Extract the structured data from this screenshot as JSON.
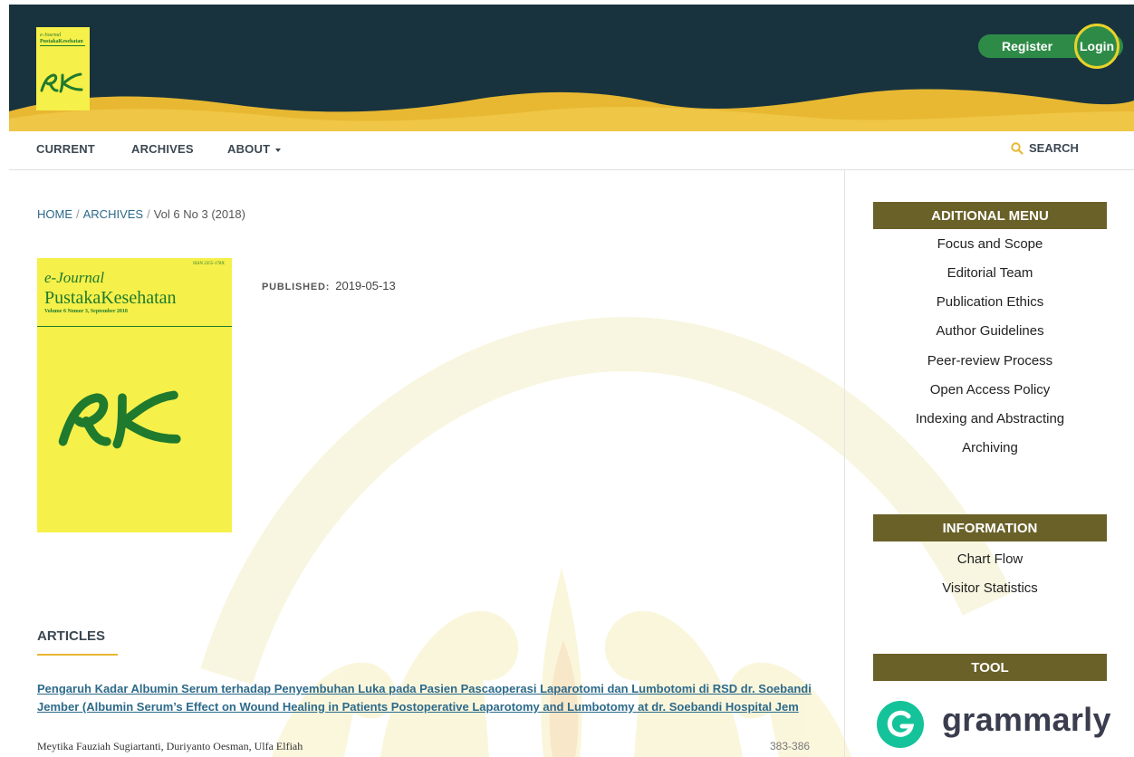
{
  "header": {
    "logo": {
      "line1": "e-Journal",
      "line2": "PustakaKesehatan",
      "mark_icon": "pk-script-logo"
    },
    "register_label": "Register",
    "login_label": "Login"
  },
  "nav": {
    "items": [
      {
        "label": "CURRENT"
      },
      {
        "label": "ARCHIVES"
      },
      {
        "label": "ABOUT"
      }
    ],
    "search_label": "SEARCH"
  },
  "breadcrumb": {
    "home": "HOME",
    "archives": "ARCHIVES",
    "current": "Vol 6 No 3 (2018)",
    "separator": "/"
  },
  "issue": {
    "cover": {
      "issn": "ISSN 2355-178X",
      "journal_italic": "e-Journal",
      "journal_name": "PustakaKesehatan",
      "volume_line": "Volume 6 Nomor 3, September 2018"
    },
    "published_label": "PUBLISHED:",
    "published_date": "2019-05-13"
  },
  "articles": {
    "heading": "ARTICLES",
    "items": [
      {
        "title": "Pengaruh Kadar Albumin Serum terhadap Penyembuhan Luka pada Pasien Pascaoperasi Laparotomi dan Lumbotomi di RSD dr. Soebandi Jember (Albumin Serum’s Effect on Wound Healing in Patients Postoperative Laparotomy and Lumbotomy at dr. Soebandi Hospital Jem",
        "authors": "Meytika Fauziah Sugiartanti, Duriyanto Oesman, Ulfa Elfiah",
        "pages": "383-386"
      }
    ]
  },
  "sidebar": {
    "additional_menu": {
      "title": "ADITIONAL MENU",
      "items": [
        "Focus and Scope",
        "Editorial Team",
        "Publication Ethics",
        "Author Guidelines",
        "Peer-review Process",
        "Open Access Policy",
        "Indexing and Abstracting",
        "Archiving"
      ]
    },
    "information": {
      "title": "INFORMATION",
      "items": [
        "Chart Flow",
        "Visitor Statistics"
      ]
    },
    "tool": {
      "title": "TOOL",
      "grammarly_text": "grammarly"
    }
  },
  "colors": {
    "header_bg": "#18333e",
    "wave_gold": "#e8b832",
    "accent_green": "#2e8b47",
    "cover_yellow": "#f6f04a",
    "sidebar_header": "#6a6129",
    "link_blue": "#2d6a8a"
  }
}
